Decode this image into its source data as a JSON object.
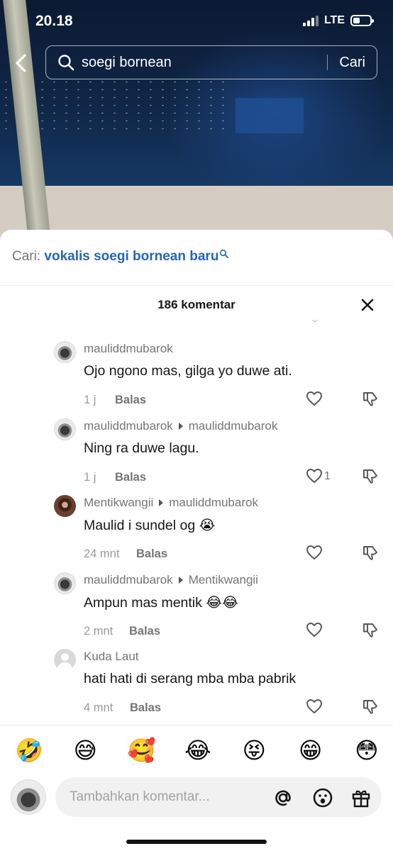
{
  "status": {
    "time": "20.18",
    "network": "LTE"
  },
  "search": {
    "query": "soegi bornean",
    "button": "Cari"
  },
  "sheet": {
    "suggest_label": "Cari:",
    "suggest_query": "vokalis soegi bornean baru",
    "comment_count": "186 komentar"
  },
  "comments": [
    {
      "user": "mauliddmubarok",
      "reply_to": "",
      "text": "Ojo ngono mas, gilga yo duwe ati.",
      "time": "1 j",
      "reply_label": "Balas",
      "likes": ""
    },
    {
      "user": "mauliddmubarok",
      "reply_to": "mauliddmubarok",
      "text": "Ning ra duwe lagu.",
      "time": "1 j",
      "reply_label": "Balas",
      "likes": "1"
    },
    {
      "user": "Mentikwangii",
      "reply_to": "mauliddmubarok",
      "text": "Maulid i sundel og 😭",
      "time": "24 mnt",
      "reply_label": "Balas",
      "likes": ""
    },
    {
      "user": "mauliddmubarok",
      "reply_to": "Mentikwangii",
      "text": "Ampun mas mentik 😂😂",
      "time": "2 mnt",
      "reply_label": "Balas",
      "likes": ""
    },
    {
      "user": "Kuda Laut",
      "reply_to": "",
      "text": "hati hati di serang mba mba pabrik",
      "time": "4 mnt",
      "reply_label": "Balas",
      "likes": ""
    }
  ],
  "emojis": [
    "🤣",
    "😅",
    "🥰",
    "😂",
    "😝",
    "😁",
    "😳"
  ],
  "composer": {
    "placeholder": "Tambahkan komentar..."
  },
  "colors": {
    "link_blue": "#2764b8",
    "text": "#161616",
    "muted": "#757575"
  }
}
